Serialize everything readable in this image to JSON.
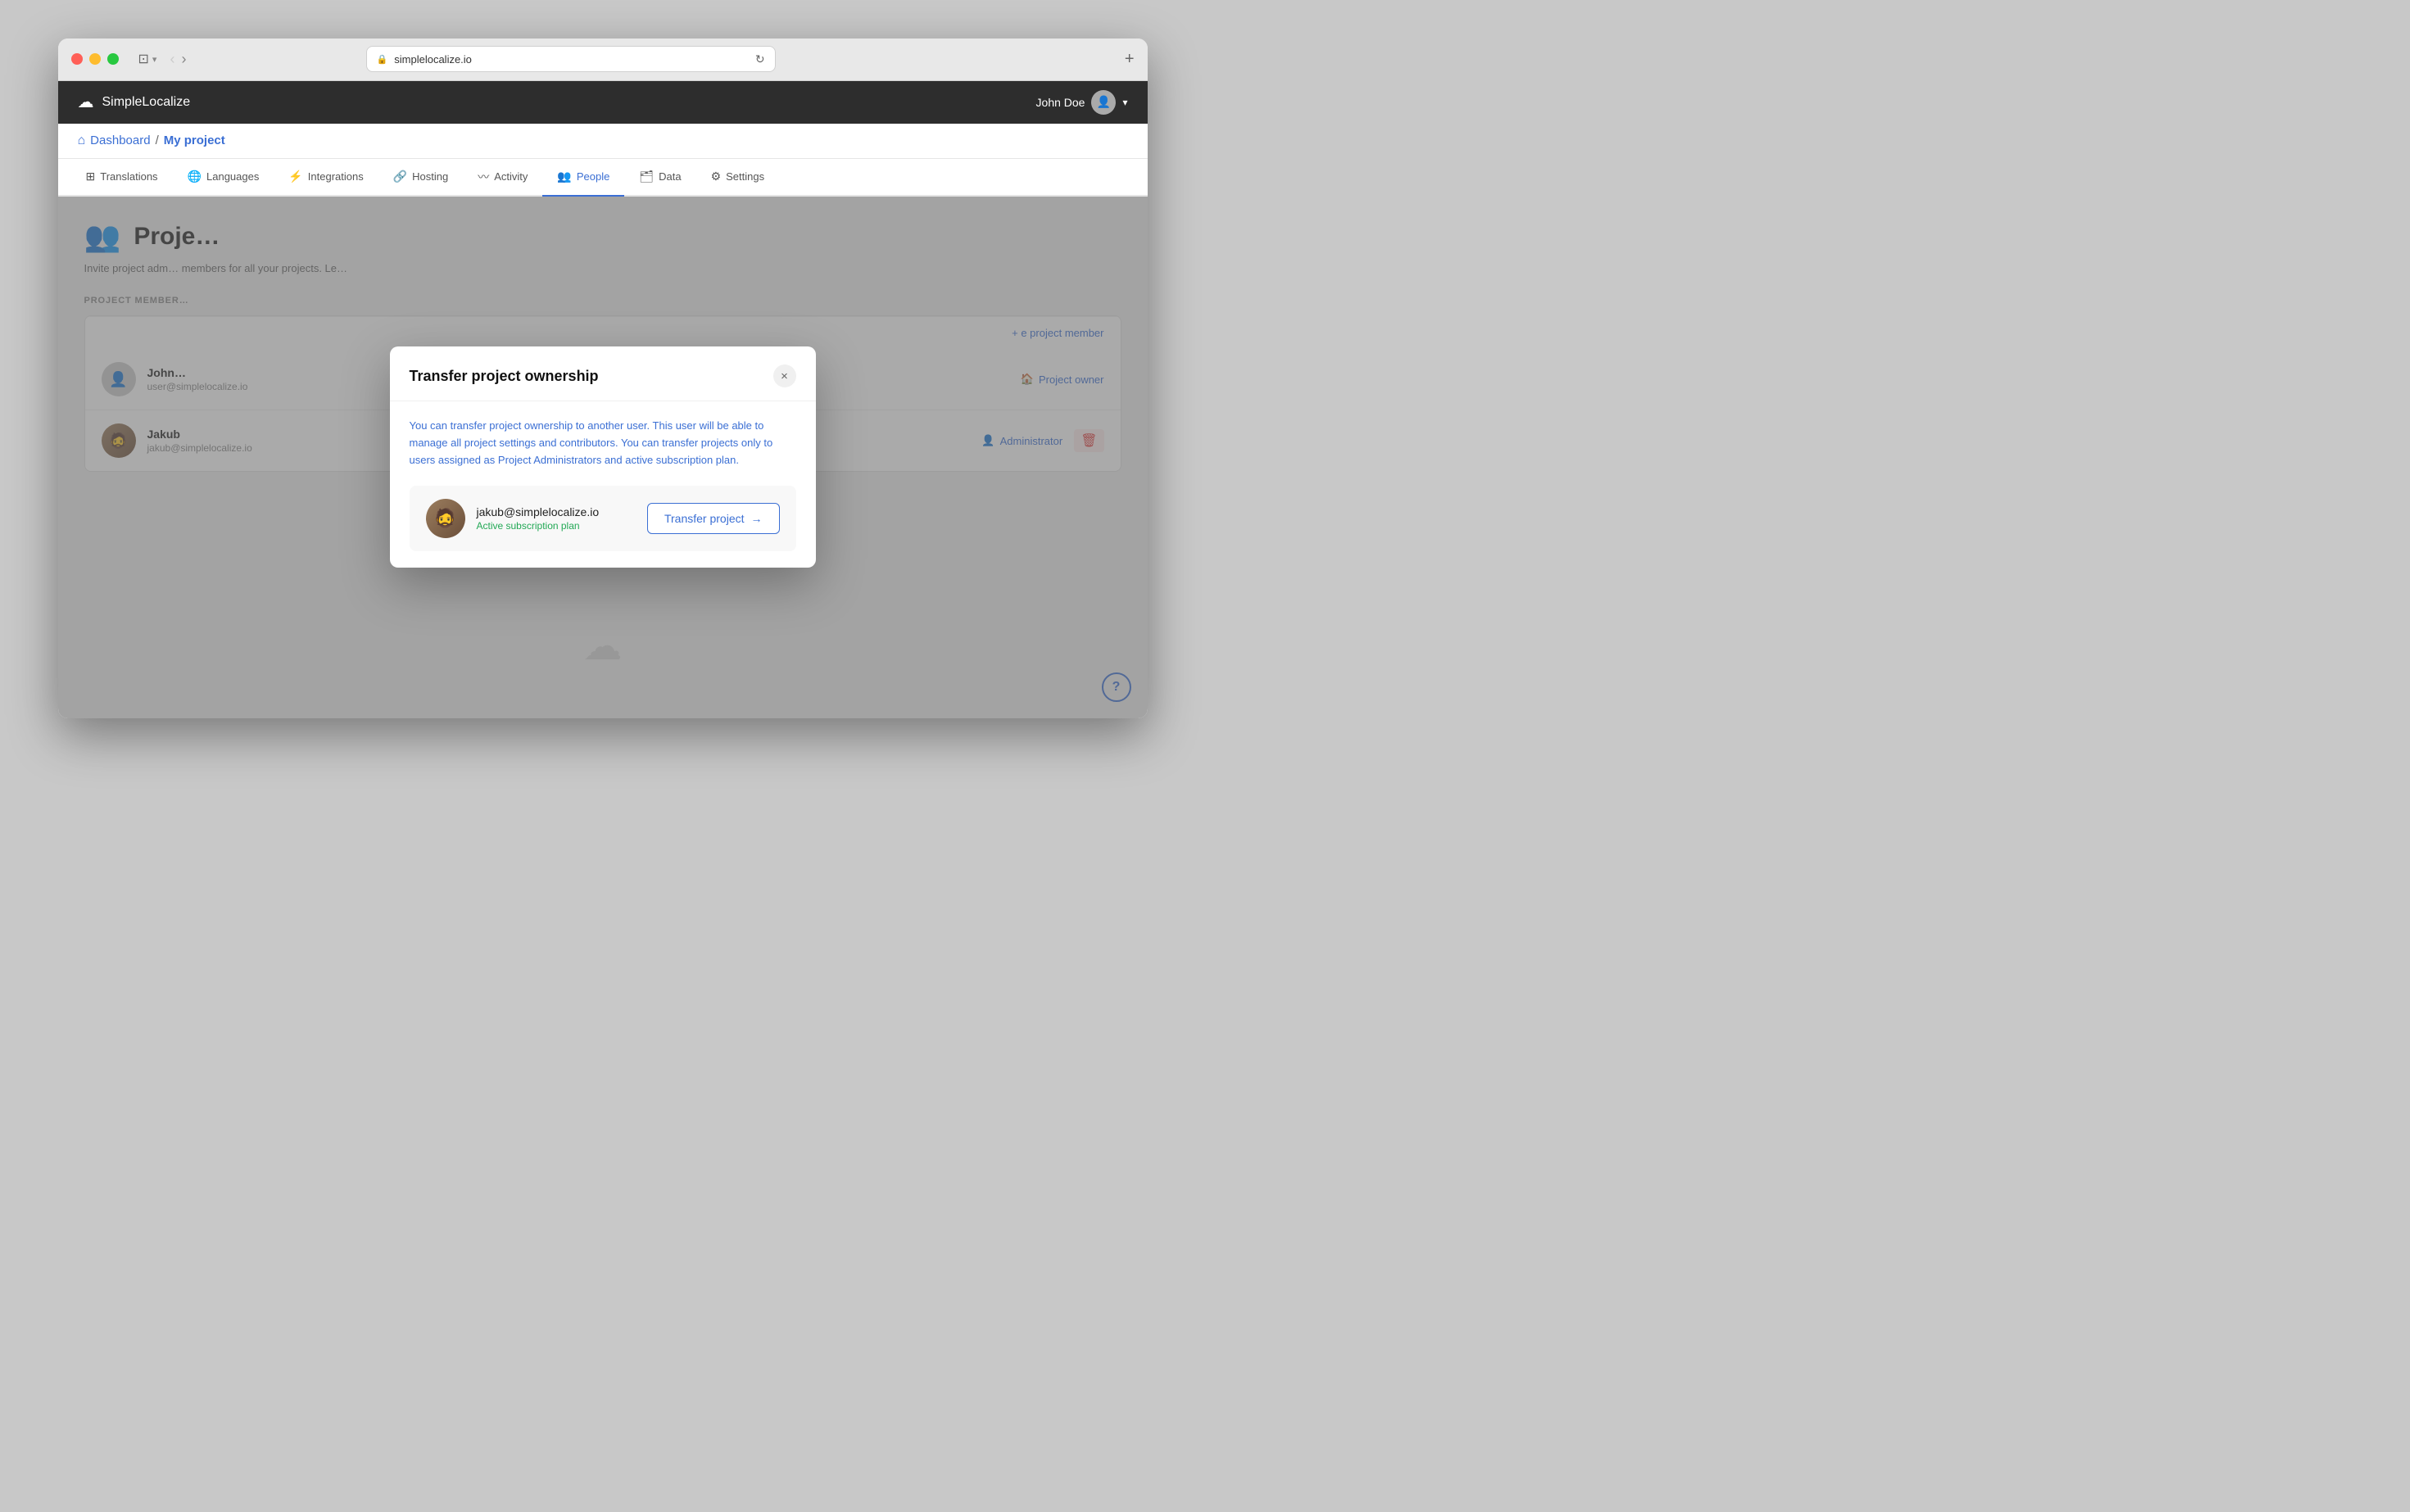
{
  "browser": {
    "url": "simplelocalize.io",
    "new_tab_label": "+"
  },
  "app": {
    "logo_name": "SimpleLocalize",
    "user_name": "John Doe"
  },
  "breadcrumb": {
    "home_icon": "⌂",
    "dashboard_label": "Dashboard",
    "separator": "/",
    "current_label": "My project"
  },
  "nav_tabs": [
    {
      "id": "translations",
      "label": "Translations",
      "icon": "⊞"
    },
    {
      "id": "languages",
      "label": "Languages",
      "icon": "🌐"
    },
    {
      "id": "integrations",
      "label": "Integrations",
      "icon": "⚡"
    },
    {
      "id": "hosting",
      "label": "Hosting",
      "icon": "🔗"
    },
    {
      "id": "activity",
      "label": "Activity",
      "icon": "〰"
    },
    {
      "id": "people",
      "label": "People",
      "icon": "👥",
      "active": true
    },
    {
      "id": "data",
      "label": "Data",
      "icon": "🗂"
    },
    {
      "id": "settings",
      "label": "Settings",
      "icon": "⚙"
    }
  ],
  "people_page": {
    "title": "Proje…",
    "description": "Invite project adm… members for all your projects. Le…",
    "section_label": "PROJECT MEMBER…",
    "add_member_label": "+ e project member",
    "members": [
      {
        "id": "john",
        "name": "John…",
        "email": "user@simplelocalize.io",
        "role": "Project owner",
        "role_icon": "🏠"
      },
      {
        "id": "jakub",
        "name": "Jakub",
        "email": "jakub@simplelocalize.io",
        "role": "Administrator",
        "role_icon": "👤"
      }
    ]
  },
  "modal": {
    "title": "Transfer project ownership",
    "close_label": "×",
    "description": "You can transfer project ownership to another user. This user will be able to manage all project settings and contributors. You can transfer projects only to users assigned as Project Administrators and active subscription plan.",
    "candidate": {
      "email": "jakub@simplelocalize.io",
      "status": "Active subscription plan"
    },
    "transfer_button_label": "Transfer project",
    "transfer_button_icon": "→"
  },
  "help_button_label": "?",
  "bottom_icon": "☁"
}
